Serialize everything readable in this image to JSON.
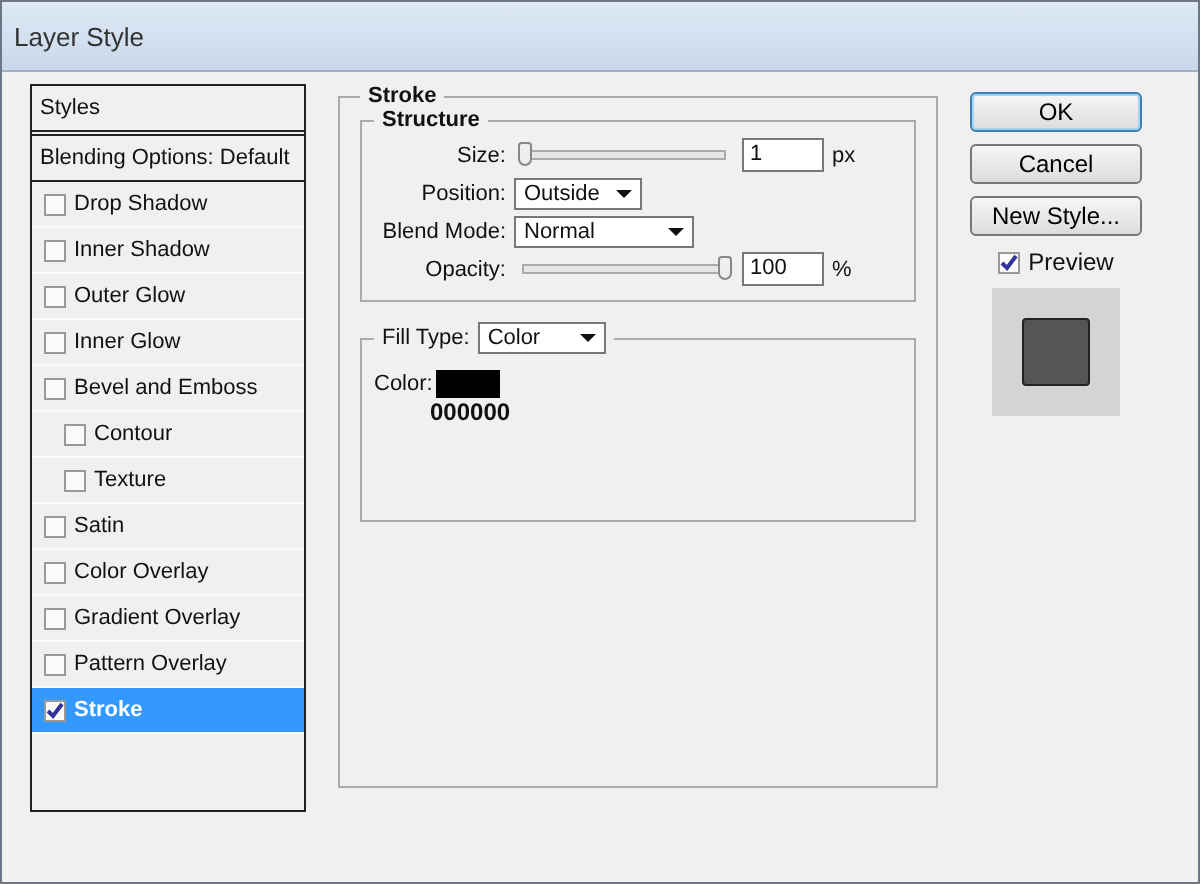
{
  "window": {
    "title": "Layer Style"
  },
  "styles_panel": {
    "header": "Styles",
    "blending_options": "Blending Options: Default",
    "items": [
      {
        "label": "Drop Shadow",
        "checked": false,
        "selected": false
      },
      {
        "label": "Inner Shadow",
        "checked": false,
        "selected": false
      },
      {
        "label": "Outer Glow",
        "checked": false,
        "selected": false
      },
      {
        "label": "Inner Glow",
        "checked": false,
        "selected": false
      },
      {
        "label": "Bevel and Emboss",
        "checked": false,
        "selected": false,
        "children": [
          {
            "label": "Contour",
            "checked": false,
            "selected": false
          },
          {
            "label": "Texture",
            "checked": false,
            "selected": false
          }
        ]
      },
      {
        "label": "Satin",
        "checked": false,
        "selected": false
      },
      {
        "label": "Color Overlay",
        "checked": false,
        "selected": false
      },
      {
        "label": "Gradient Overlay",
        "checked": false,
        "selected": false
      },
      {
        "label": "Pattern Overlay",
        "checked": false,
        "selected": false
      },
      {
        "label": "Stroke",
        "checked": true,
        "selected": true
      }
    ]
  },
  "stroke": {
    "title": "Stroke",
    "structure": {
      "title": "Structure",
      "size": {
        "label": "Size:",
        "level": 0,
        "value": "1",
        "unit": "px"
      },
      "position": {
        "label": "Position:",
        "value": "Outside"
      },
      "blend_mode": {
        "label": "Blend Mode:",
        "value": "Normal"
      },
      "opacity": {
        "label": "Opacity:",
        "level": 1,
        "value": "100",
        "unit": "%"
      }
    },
    "fill_type": {
      "label": "Fill Type:",
      "value": "Color",
      "color_label": "Color:",
      "color": "#000000",
      "hex": "000000"
    }
  },
  "buttons": [
    "OK",
    "Cancel",
    "New Style..."
  ],
  "preview": {
    "label": "Preview",
    "checked": true
  }
}
